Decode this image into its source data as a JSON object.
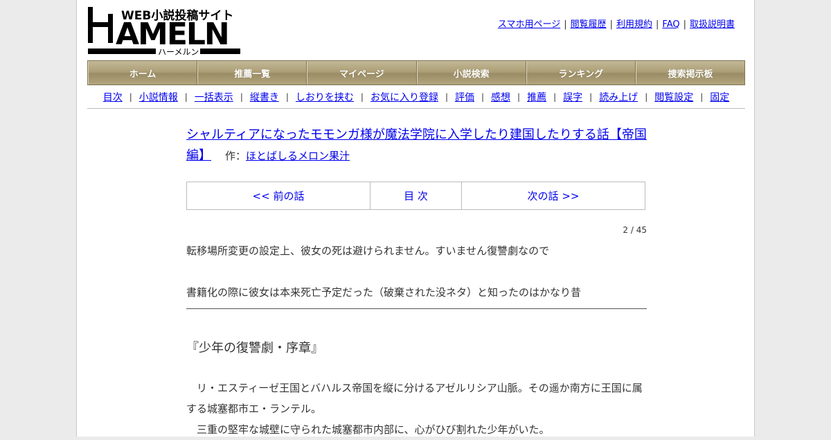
{
  "site": {
    "logo_text": "HAMELN",
    "logo_tagline": "WEB小説投稿サイト",
    "logo_kana": "ハーメルン"
  },
  "util_links": [
    "スマホ用ページ",
    "閲覧履歴",
    "利用規約",
    "FAQ",
    "取扱説明書"
  ],
  "global_nav": [
    "ホーム",
    "推薦一覧",
    "マイページ",
    "小説検索",
    "ランキング",
    "捜索掲示板"
  ],
  "sub_nav": [
    "目次",
    "小説情報",
    "一括表示",
    "縦書き",
    "しおりを挟む",
    "お気に入り登録",
    "評価",
    "感想",
    "推薦",
    "誤字",
    "読み上げ",
    "閲覧設定",
    "固定"
  ],
  "novel": {
    "title": "シャルティアになったモモンガ様が魔法学院に入学したり建国したりする話【帝国編】",
    "author_prefix": "作：",
    "author": "ほとばしるメロン果汁"
  },
  "episode_nav": {
    "prev": "<< 前の話",
    "toc": "目 次",
    "next": "次の話 >>"
  },
  "page_count": "2 / 45",
  "preface": [
    "転移場所変更の設定上、彼女の死は避けられません。すいません復讐劇なので",
    "書籍化の際に彼女は本来死亡予定だった（破棄された没ネタ）と知ったのはかなり昔"
  ],
  "chapter_title": "『少年の復讐劇・序章』",
  "body_text": [
    "　リ・エスティーゼ王国とバハルス帝国を縦に分けるアゼルリシア山脈。その遥か南方に王国に属する城塞都市エ・ランテル。",
    "　三重の堅牢な城壁に守られた城塞都市内部に、心がひび割れた少年がいた。"
  ],
  "colors": {
    "link": "#0000ee",
    "nav_bg": "#ad9f77",
    "page_bg": "#ebebeb"
  }
}
